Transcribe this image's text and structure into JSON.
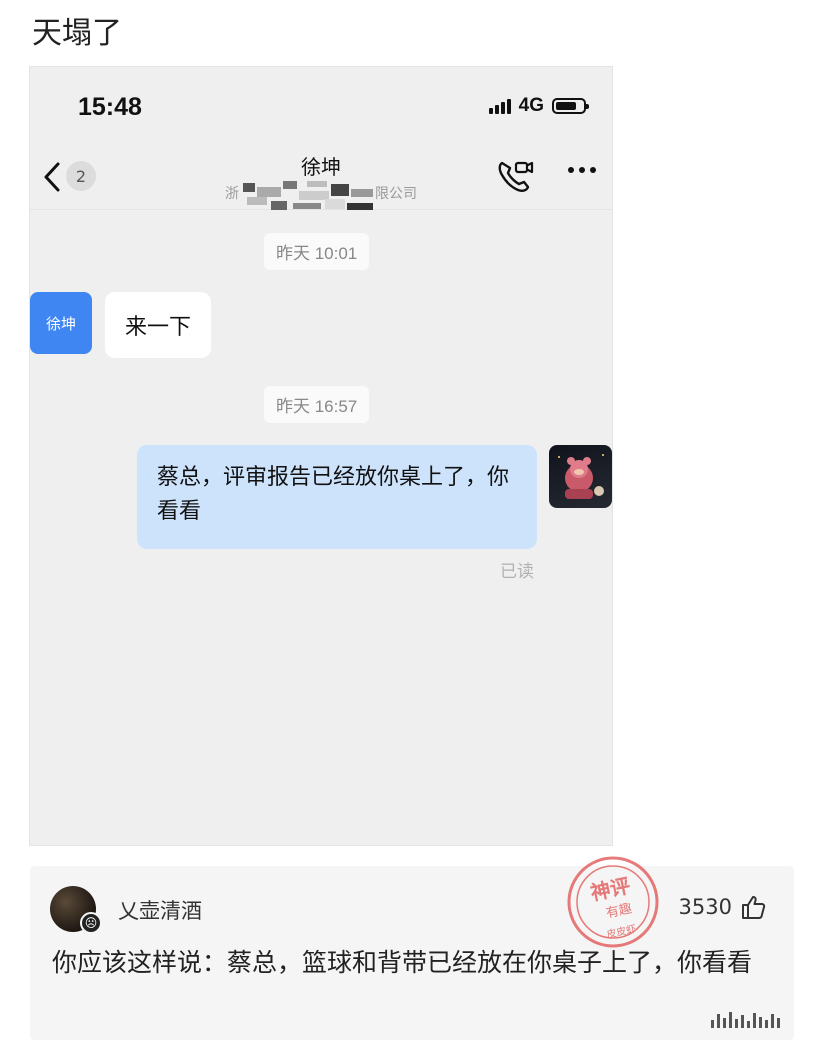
{
  "post": {
    "title": "天塌了"
  },
  "status_bar": {
    "time": "15:48",
    "network": "4G",
    "battery_level": 0.78
  },
  "chat_header": {
    "unread_count": "2",
    "contact_name": "徐坤",
    "company_prefix": "浙",
    "company_suffix": "限公司"
  },
  "messages": {
    "time1": "昨天 10:01",
    "incoming_avatar_label": "徐坤",
    "incoming_text": "来一下",
    "time2": "昨天 16:57",
    "outgoing_text": "蔡总，评审报告已经放你桌上了，你看看",
    "read_status": "已读"
  },
  "comment": {
    "username": "乂壶清酒",
    "likes": "3530",
    "text": "你应该这样说：蔡总，篮球和背带已经放在你桌子上了，你看看"
  },
  "watermark": {
    "line1": "神评",
    "line2": "有趣",
    "line3": "皮皮虾"
  },
  "colors": {
    "accent_blue": "#3f86f2",
    "outgoing_bubble": "#cde3fb",
    "stamp_red": "#e25a5a"
  }
}
